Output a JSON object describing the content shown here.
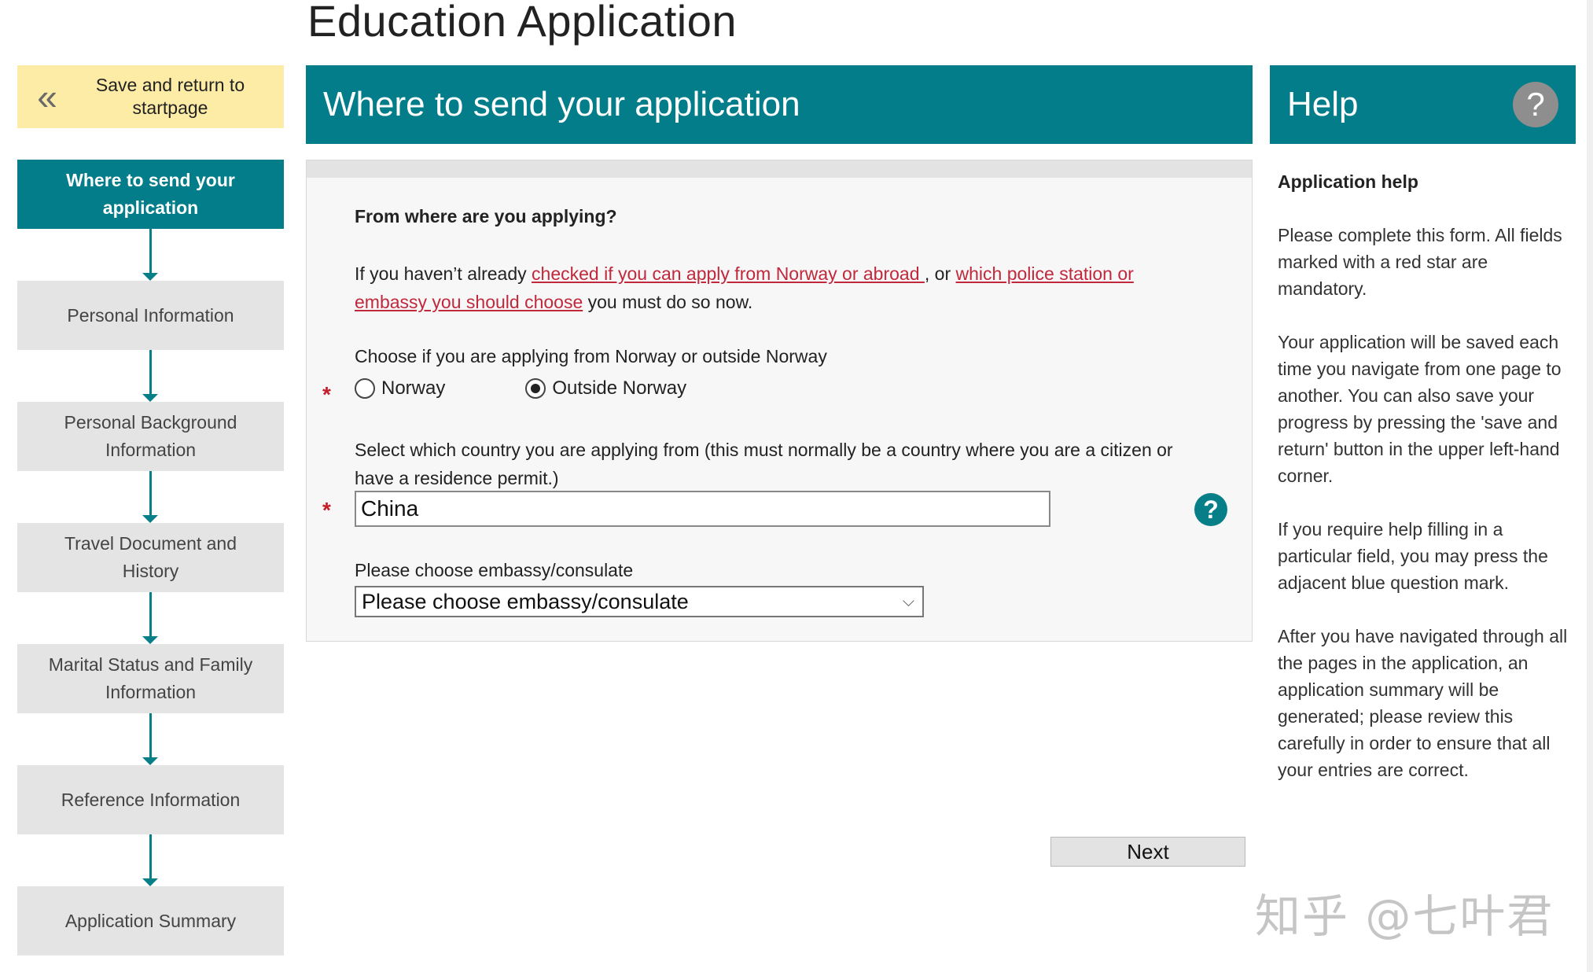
{
  "page": {
    "title": "Education Application"
  },
  "sidebar": {
    "save_return": {
      "icon": "«",
      "label": "Save and return to startpage"
    },
    "steps": [
      {
        "label": "Where to send your application",
        "active": true
      },
      {
        "label": "Personal Information",
        "active": false
      },
      {
        "label": "Personal Background Information",
        "active": false
      },
      {
        "label": "Travel Document and History",
        "active": false
      },
      {
        "label": "Marital Status and Family Information",
        "active": false
      },
      {
        "label": "Reference Information",
        "active": false
      },
      {
        "label": "Application Summary",
        "active": false
      }
    ]
  },
  "main": {
    "header": "Where to send your application",
    "question_title": "From where are you applying?",
    "intro": {
      "before": "If you haven’t already ",
      "link1": "checked if you can apply from Norway or abroad ",
      "middle": ", or ",
      "link2": "which police station or embassy you should choose",
      "after": " you must do so now."
    },
    "location": {
      "label": "Choose if you are applying from Norway or outside Norway",
      "required_mark": "*",
      "options": [
        {
          "label": "Norway",
          "selected": false
        },
        {
          "label": "Outside Norway",
          "selected": true
        }
      ]
    },
    "country": {
      "label": "Select which country you are applying from (this must normally be a country where you are a citizen or have a residence permit.)",
      "required_mark": "*",
      "value": "China",
      "help_icon": "?"
    },
    "embassy": {
      "label": "Please choose embassy/consulate",
      "selected": "Please choose embassy/consulate",
      "caret": "⌵"
    },
    "next_label": "Next"
  },
  "help": {
    "header": "Help",
    "icon": "?",
    "title": "Application help",
    "paragraphs": [
      "Please complete this form. All fields marked with a red star are mandatory.",
      "Your application will be saved each time you navigate from one page to another. You can also save your progress by pressing the 'save and return' button in the upper left-hand corner.",
      "If you require help filling in a particular field, you may press the adjacent blue question mark.",
      "After you have navigated through all the pages in the application, an application summary will be generated; please review this carefully in order to ensure that all your entries are correct."
    ]
  },
  "watermark": "知乎 @七叶君",
  "colors": {
    "teal": "#027d89",
    "save_bg": "#fdeca6",
    "step_bg": "#e4e4e4",
    "required": "#c41e2a",
    "link": "#c0283c"
  }
}
